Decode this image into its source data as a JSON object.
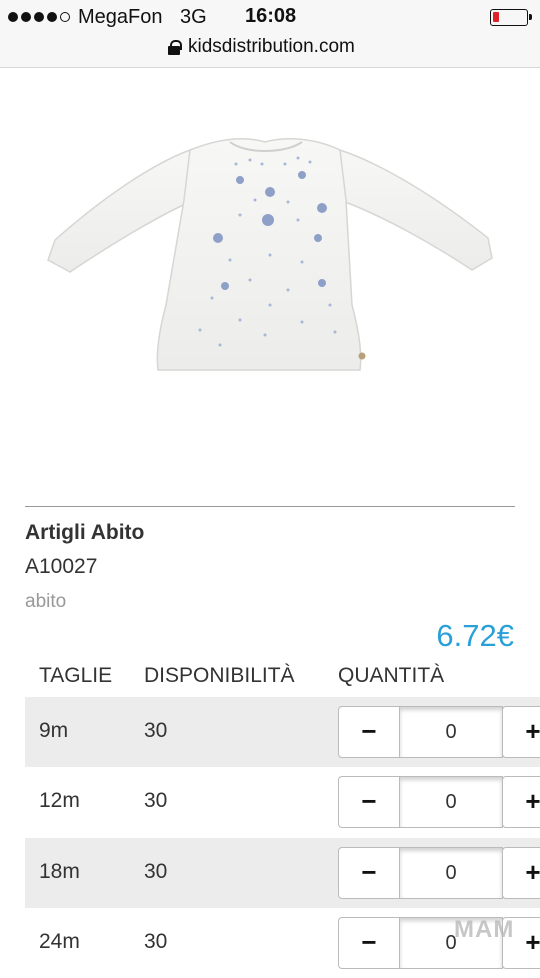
{
  "status_bar": {
    "carrier": "MegaFon",
    "network": "3G",
    "time": "16:08"
  },
  "browser": {
    "url": "kidsdistribution.com"
  },
  "product": {
    "image_alt": "white long-sleeve top",
    "title": "Artigli Abito",
    "code": "A10027",
    "category": "abito",
    "price": "6.72€"
  },
  "table": {
    "headers": [
      "TAGLIE",
      "DISPONIBILITÀ",
      "QUANTITÀ"
    ],
    "rows": [
      {
        "size": "9m",
        "availability": "30",
        "quantity": "0"
      },
      {
        "size": "12m",
        "availability": "30",
        "quantity": "0"
      },
      {
        "size": "18m",
        "availability": "30",
        "quantity": "0"
      },
      {
        "size": "24m",
        "availability": "30",
        "quantity": "0"
      }
    ],
    "minus_label": "−",
    "plus_label": "+"
  },
  "watermark": "МАМ",
  "colors": {
    "price": "#2aa0d8",
    "row_shade": "#ececec",
    "battery_low": "#e0232a"
  }
}
